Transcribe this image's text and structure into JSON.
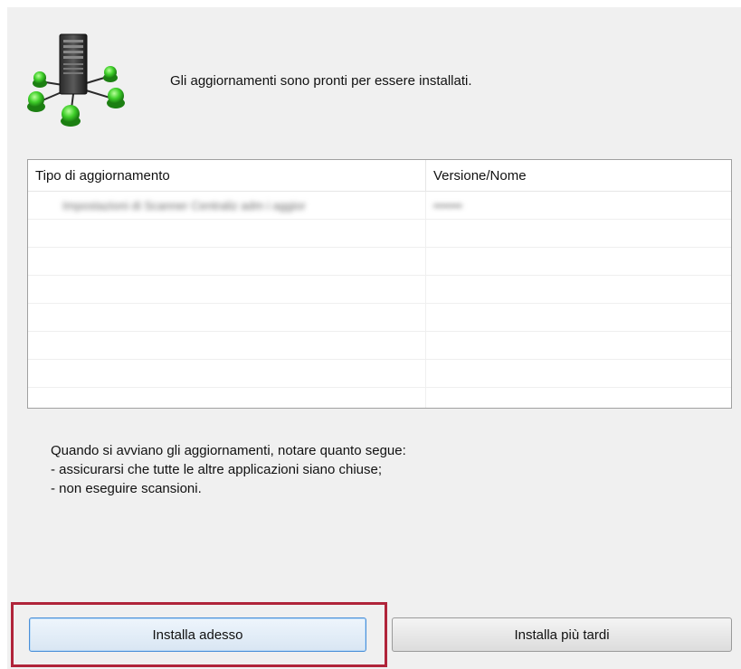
{
  "header": {
    "icon": "server-network-icon",
    "message": "Gli aggiornamenti sono pronti per essere installati."
  },
  "table": {
    "columns": [
      "Tipo di aggiornamento",
      "Versione/Nome"
    ],
    "rows": [
      {
        "type": "Impostazioni di Scanner Centraliz adm i aggior",
        "version": "•••••••"
      },
      {
        "type": "",
        "version": ""
      },
      {
        "type": "",
        "version": ""
      },
      {
        "type": "",
        "version": ""
      },
      {
        "type": "",
        "version": ""
      },
      {
        "type": "",
        "version": ""
      },
      {
        "type": "",
        "version": ""
      },
      {
        "type": "",
        "version": ""
      }
    ]
  },
  "notes": {
    "line1": "Quando si avviano gli aggiornamenti, notare quanto segue:",
    "line2": "- assicurarsi che tutte le altre applicazioni siano chiuse;",
    "line3": "- non eseguire scansioni."
  },
  "buttons": {
    "install_now": "Installa adesso",
    "install_later": "Installa più tardi"
  },
  "colors": {
    "highlight": "#b0243a",
    "node_green": "#3fcf2a",
    "dialog_bg": "#f0f0f0"
  }
}
